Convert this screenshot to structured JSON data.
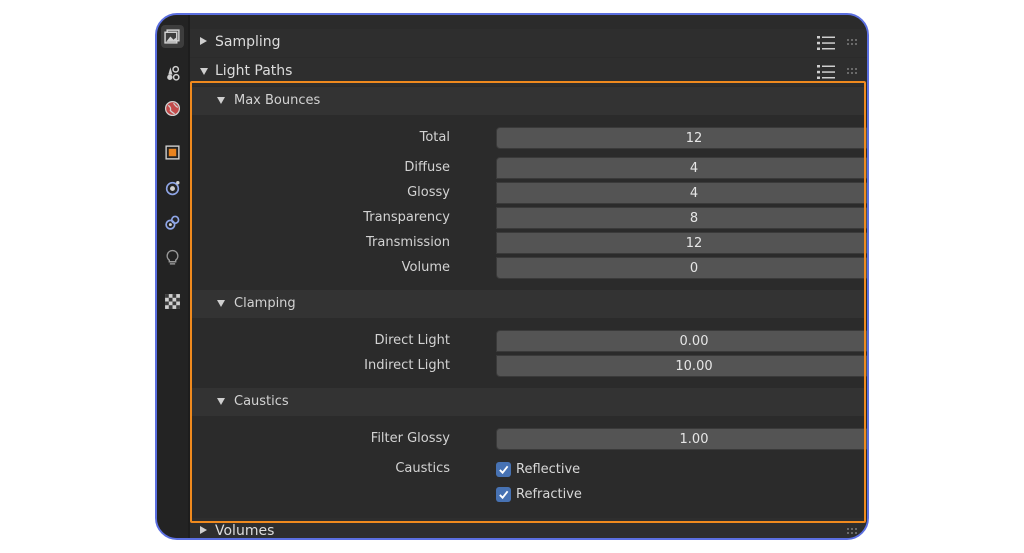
{
  "panels": {
    "sampling": {
      "label": "Sampling"
    },
    "light_paths": {
      "label": "Light Paths"
    },
    "volumes": {
      "label": "Volumes"
    }
  },
  "max_bounces": {
    "header": "Max Bounces",
    "total": {
      "label": "Total",
      "value": "12"
    },
    "diffuse": {
      "label": "Diffuse",
      "value": "4"
    },
    "glossy": {
      "label": "Glossy",
      "value": "4"
    },
    "transparency": {
      "label": "Transparency",
      "value": "8"
    },
    "transmission": {
      "label": "Transmission",
      "value": "12"
    },
    "volume": {
      "label": "Volume",
      "value": "0"
    }
  },
  "clamping": {
    "header": "Clamping",
    "direct_light": {
      "label": "Direct Light",
      "value": "0.00"
    },
    "indirect_light": {
      "label": "Indirect Light",
      "value": "10.00"
    }
  },
  "caustics": {
    "header": "Caustics",
    "filter_glossy": {
      "label": "Filter Glossy",
      "value": "1.00"
    },
    "caustics_label": "Caustics",
    "reflective": {
      "label": "Reflective",
      "checked": true
    },
    "refractive": {
      "label": "Refractive",
      "checked": true
    }
  },
  "tabs": [
    "render-icon",
    "tool-icon",
    "world-icon",
    "object-icon",
    "physics-icon",
    "constraints-icon",
    "light-icon",
    "texture-icon"
  ],
  "colors": {
    "highlight": "#f08a1e",
    "frame": "#5b6fe0",
    "checkbox": "#4772b3"
  }
}
